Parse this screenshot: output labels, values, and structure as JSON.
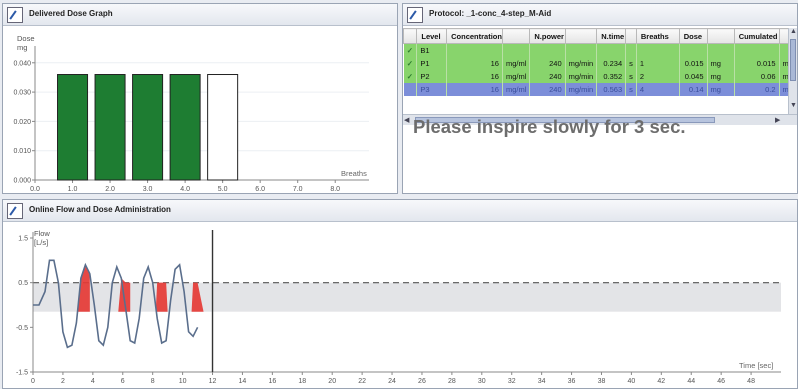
{
  "dose_panel": {
    "title": "Delivered Dose Graph",
    "y_label": "Dose",
    "y_unit": "mg",
    "x_label": "Breaths"
  },
  "protocol_panel": {
    "title": "Protocol: _1-conc_4-step_M-Aid",
    "columns": [
      "",
      "Level",
      "Concentration",
      "",
      "N.power",
      "",
      "N.time",
      "",
      "Breaths",
      "Dose",
      "",
      "Cumulated",
      ""
    ],
    "rows": [
      {
        "status": "✓",
        "level": "B1",
        "concentration": "",
        "conc_unit": "",
        "npower": "",
        "npower_unit": "",
        "ntime": "",
        "ntime_unit": "",
        "breaths": "",
        "dose": "",
        "dose_unit": "",
        "cumulated": "",
        "cum_unit": "",
        "style": "green"
      },
      {
        "status": "✓",
        "level": "P1",
        "concentration": "16",
        "conc_unit": "mg/ml",
        "npower": "240",
        "npower_unit": "mg/min",
        "ntime": "0.234",
        "ntime_unit": "s",
        "breaths": "1",
        "dose": "0.015",
        "dose_unit": "mg",
        "cumulated": "0.015",
        "cum_unit": "mg",
        "style": "green"
      },
      {
        "status": "✓",
        "level": "P2",
        "concentration": "16",
        "conc_unit": "mg/ml",
        "npower": "240",
        "npower_unit": "mg/min",
        "ntime": "0.352",
        "ntime_unit": "s",
        "breaths": "2",
        "dose": "0.045",
        "dose_unit": "mg",
        "cumulated": "0.06",
        "cum_unit": "mg",
        "style": "green"
      },
      {
        "status": "",
        "level": "P3",
        "concentration": "16",
        "conc_unit": "mg/ml",
        "npower": "240",
        "npower_unit": "mg/min",
        "ntime": "0.563",
        "ntime_unit": "s",
        "breaths": "4",
        "dose": "0.14",
        "dose_unit": "mg",
        "cumulated": "0.2",
        "cum_unit": "mg",
        "style": "blue"
      }
    ],
    "instruction": "Please inspire slowly for 3 sec."
  },
  "flow_panel": {
    "title": "Online Flow and Dose Administration",
    "y_label": "Flow",
    "y_unit": "[L/s]",
    "x_label": "Time  [sec]"
  },
  "chart_data": [
    {
      "type": "bar",
      "title": "Delivered Dose Graph",
      "ylabel": "Dose mg",
      "xlabel": "Breaths",
      "x_ticks": [
        0.0,
        1.0,
        2.0,
        3.0,
        4.0,
        5.0,
        6.0,
        7.0,
        8.0
      ],
      "y_ticks": [
        0.0,
        0.01,
        0.02,
        0.03,
        0.04
      ],
      "xlim": [
        0,
        8.9
      ],
      "ylim": [
        0,
        0.043
      ],
      "bars": [
        {
          "x": 1.0,
          "value": 0.036,
          "color": "#1e7d32",
          "state": "delivered"
        },
        {
          "x": 2.0,
          "value": 0.036,
          "color": "#1e7d32",
          "state": "delivered"
        },
        {
          "x": 3.0,
          "value": 0.036,
          "color": "#1e7d32",
          "state": "delivered"
        },
        {
          "x": 4.0,
          "value": 0.036,
          "color": "#1e7d32",
          "state": "delivered"
        },
        {
          "x": 5.0,
          "value": 0.036,
          "color": "#ffffff",
          "state": "pending"
        }
      ]
    },
    {
      "type": "line",
      "title": "Online Flow and Dose Administration",
      "ylabel": "Flow [L/s]",
      "xlabel": "Time [sec]",
      "xlim": [
        0,
        50
      ],
      "ylim": [
        -1.5,
        1.5
      ],
      "x_ticks": [
        0,
        2,
        4,
        6,
        8,
        10,
        12,
        14,
        16,
        18,
        20,
        22,
        24,
        26,
        28,
        30,
        32,
        34,
        36,
        38,
        40,
        42,
        44,
        46,
        48
      ],
      "y_ticks": [
        -1.5,
        -0.5,
        0.5,
        1.5
      ],
      "target_band": [
        -0.15,
        0.5
      ],
      "cursor_x": 12,
      "series": [
        {
          "x": [
            0.0,
            0.4,
            0.8,
            1.1,
            1.4,
            1.7,
            2.0,
            2.3,
            2.6,
            2.9,
            3.2,
            3.5,
            3.8,
            4.1,
            4.4,
            4.7,
            5.0,
            5.3,
            5.6,
            5.9,
            6.2,
            6.5,
            6.8,
            7.1,
            7.4,
            7.7,
            8.0,
            8.3,
            8.6,
            8.9,
            9.2,
            9.5,
            9.8,
            10.1,
            10.4,
            10.7,
            11.0
          ],
          "y": [
            0.0,
            0.0,
            0.3,
            1.0,
            1.0,
            0.5,
            -0.6,
            -0.95,
            -0.9,
            -0.4,
            0.6,
            0.9,
            0.7,
            0.0,
            -0.8,
            -0.9,
            -0.5,
            0.5,
            0.85,
            0.6,
            -0.1,
            -0.8,
            -0.85,
            -0.3,
            0.6,
            0.85,
            0.5,
            -0.3,
            -0.85,
            -0.8,
            0.1,
            0.8,
            0.9,
            0.3,
            -0.6,
            -0.7,
            -0.5
          ],
          "color": "#5a6e8c"
        }
      ],
      "dose_pulses": [
        [
          3.0,
          3.8
        ],
        [
          5.7,
          6.5
        ],
        [
          8.2,
          9.0
        ],
        [
          10.6,
          11.4
        ]
      ],
      "pulse_color": "#e53935"
    }
  ]
}
